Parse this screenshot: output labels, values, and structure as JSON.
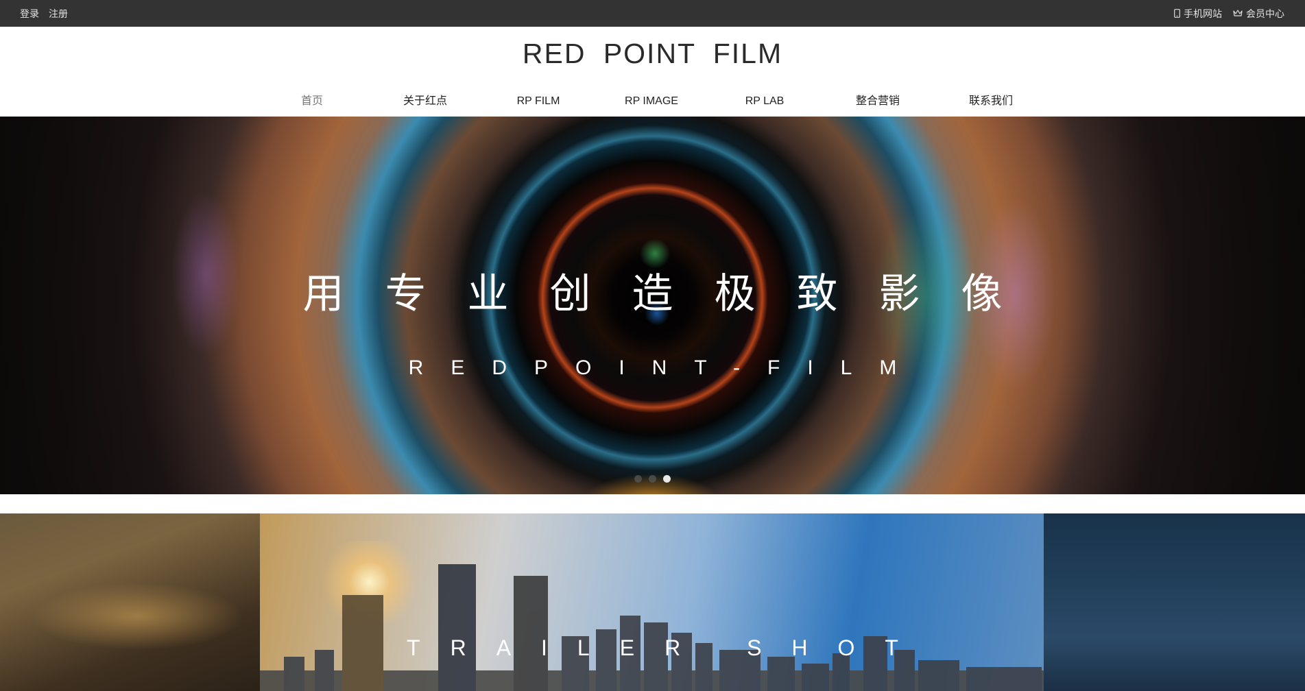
{
  "topbar": {
    "login": "登录",
    "register": "注册",
    "mobile_site": "手机网站",
    "member_center": "会员中心",
    "mobile_icon": "phone-icon",
    "member_icon": "crown-icon"
  },
  "header": {
    "logo": "RED POINT FILM",
    "nav": [
      {
        "label": "首页",
        "active": true
      },
      {
        "label": "关于红点"
      },
      {
        "label": "RP FILM"
      },
      {
        "label": "RP IMAGE"
      },
      {
        "label": "RP LAB"
      },
      {
        "label": "整合营销"
      },
      {
        "label": "联系我们"
      }
    ]
  },
  "hero": {
    "title": "用专业创造极致影像",
    "subtitle": "REDPOINT-FILM",
    "slides_total": 3,
    "active_slide": 3
  },
  "showcase": {
    "title": "TRAILER SHOT"
  },
  "colors": {
    "topbar_bg": "#333333",
    "nav_active": "#777777"
  }
}
